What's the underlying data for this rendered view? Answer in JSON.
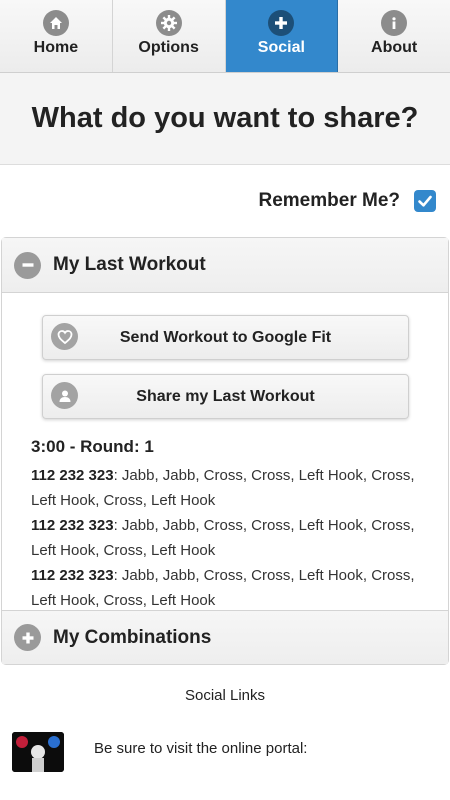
{
  "nav": {
    "tabs": [
      {
        "label": "Home",
        "icon": "home-icon",
        "active": false
      },
      {
        "label": "Options",
        "icon": "gear-icon",
        "active": false
      },
      {
        "label": "Social",
        "icon": "plus-icon",
        "active": true
      },
      {
        "label": "About",
        "icon": "info-icon",
        "active": false
      }
    ]
  },
  "header": {
    "title": "What do you want to share?"
  },
  "remember": {
    "label": "Remember Me?",
    "checked": true
  },
  "last_workout": {
    "title": "My Last Workout",
    "buttons": {
      "google_fit": "Send Workout to Google Fit",
      "share": "Share my Last Workout"
    },
    "workout_title": "3:00 - Round: 1",
    "rounds": [
      {
        "code": "112 232 323",
        "text": ": Jabb, Jabb, Cross, Cross, Left Hook, Cross, Left Hook, Cross, Left Hook"
      },
      {
        "code": "112 232 323",
        "text": ": Jabb, Jabb, Cross, Cross, Left Hook, Cross, Left Hook, Cross, Left Hook"
      },
      {
        "code": "112 232 323",
        "text": ": Jabb, Jabb, Cross, Cross, Left Hook, Cross, Left Hook, Cross, Left Hook"
      }
    ]
  },
  "combinations": {
    "title": "My Combinations"
  },
  "footer": {
    "social_links_title": "Social Links",
    "portal_text": "Be sure to visit the online portal:"
  },
  "colors": {
    "accent": "#3388cc",
    "icon_gray": "#9a9a9a"
  }
}
